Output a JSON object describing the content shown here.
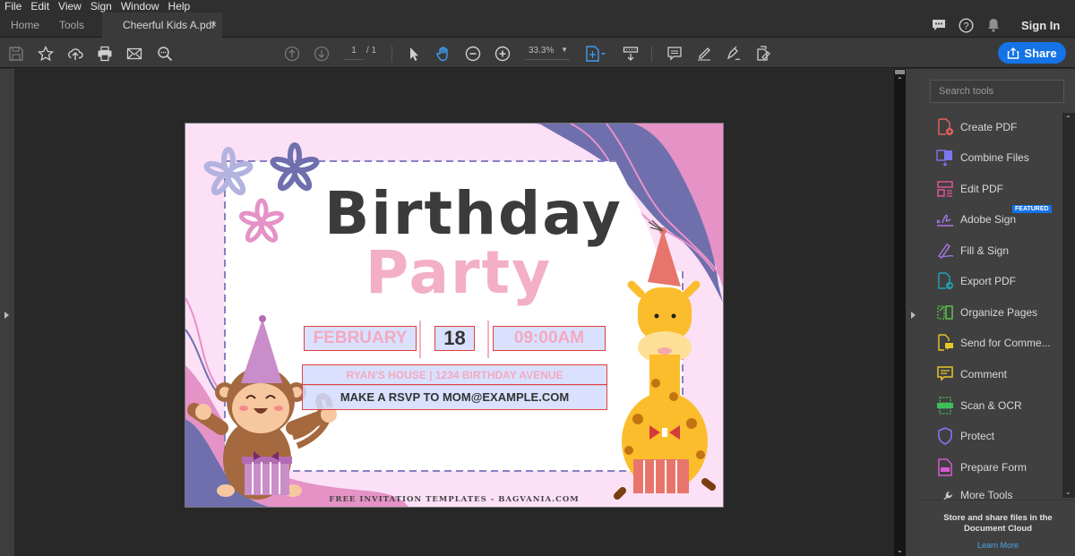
{
  "menu": {
    "items": [
      "File",
      "Edit",
      "View",
      "Sign",
      "Window",
      "Help"
    ]
  },
  "tabs": {
    "home": "Home",
    "tools": "Tools",
    "document": "Cheerful Kids A.pdf",
    "close": "×"
  },
  "header_right": {
    "sign_in": "Sign In"
  },
  "toolbar": {
    "page_current": "1",
    "page_total": "/ 1",
    "zoom": "33.3%",
    "share_label": "Share"
  },
  "tools_panel": {
    "search_placeholder": "Search tools",
    "featured_badge": "FEATURED",
    "items": [
      {
        "label": "Create PDF",
        "color": "#e8605c"
      },
      {
        "label": "Combine Files",
        "color": "#7b76f0"
      },
      {
        "label": "Edit PDF",
        "color": "#e5579d"
      },
      {
        "label": "Adobe Sign",
        "color": "#a578e6"
      },
      {
        "label": "Fill & Sign",
        "color": "#a578e6"
      },
      {
        "label": "Export PDF",
        "color": "#21a5b4"
      },
      {
        "label": "Organize Pages",
        "color": "#5cc24a"
      },
      {
        "label": "Send for Comme...",
        "color": "#e8c62a"
      },
      {
        "label": "Comment",
        "color": "#e8c62a"
      },
      {
        "label": "Scan & OCR",
        "color": "#3fbf5a"
      },
      {
        "label": "Protect",
        "color": "#7b76f0"
      },
      {
        "label": "Prepare Form",
        "color": "#d45ad1"
      },
      {
        "label": "More Tools",
        "color": "#cccccc"
      }
    ],
    "cloud_text": "Store and share files in the Document Cloud",
    "learn_more": "Learn More"
  },
  "pdf": {
    "title_line1": "Birthday",
    "title_line2": "Party",
    "month": "FEBRUARY",
    "day": "18",
    "time": "09:00AM",
    "address": "RYAN'S HOUSE | 1234 BIRTHDAY AVENUE",
    "rsvp": "MAKE A RSVP TO MOM@EXAMPLE.COM",
    "footer": "FREE INVITATION TEMPLATES - BAGVANIA.COM"
  },
  "colors": {
    "accent": "#1473e6",
    "title_dark": "#3b3b3b",
    "title_pink": "#f2afc6",
    "field_border": "#e53e3e"
  }
}
